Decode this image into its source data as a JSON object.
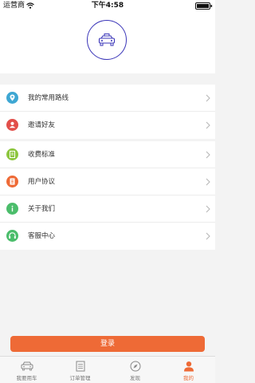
{
  "status_bar": {
    "carrier": "运营商",
    "time": "下午4:58",
    "wifi_icon": "wifi-icon",
    "battery_icon": "battery-icon"
  },
  "header": {
    "avatar_icon": "taxi-car-icon",
    "avatar_border_color": "#3a35b8"
  },
  "menu": {
    "group1": [
      {
        "label": "我的常用路线",
        "icon": "location-pin-icon",
        "color": "#3ea7d3"
      },
      {
        "label": "邀请好友",
        "icon": "person-icon",
        "color": "#e24f4a"
      }
    ],
    "group2": [
      {
        "label": "收费标准",
        "icon": "price-list-icon",
        "color": "#8dc63f"
      },
      {
        "label": "用户协议",
        "icon": "document-icon",
        "color": "#ee6a36"
      },
      {
        "label": "关于我们",
        "icon": "info-icon",
        "color": "#4bbd6b"
      },
      {
        "label": "客服中心",
        "icon": "headset-icon",
        "color": "#4bbd6b"
      }
    ]
  },
  "login_button": {
    "label": "登录",
    "color": "#ee6a36"
  },
  "tab_bar": {
    "tabs": [
      {
        "label": "我要用车",
        "icon": "car-icon",
        "active": false
      },
      {
        "label": "订单管理",
        "icon": "order-list-icon",
        "active": false
      },
      {
        "label": "发现",
        "icon": "compass-icon",
        "active": false
      },
      {
        "label": "我的",
        "icon": "user-icon",
        "active": true
      }
    ],
    "active_color": "#ee6a36"
  }
}
